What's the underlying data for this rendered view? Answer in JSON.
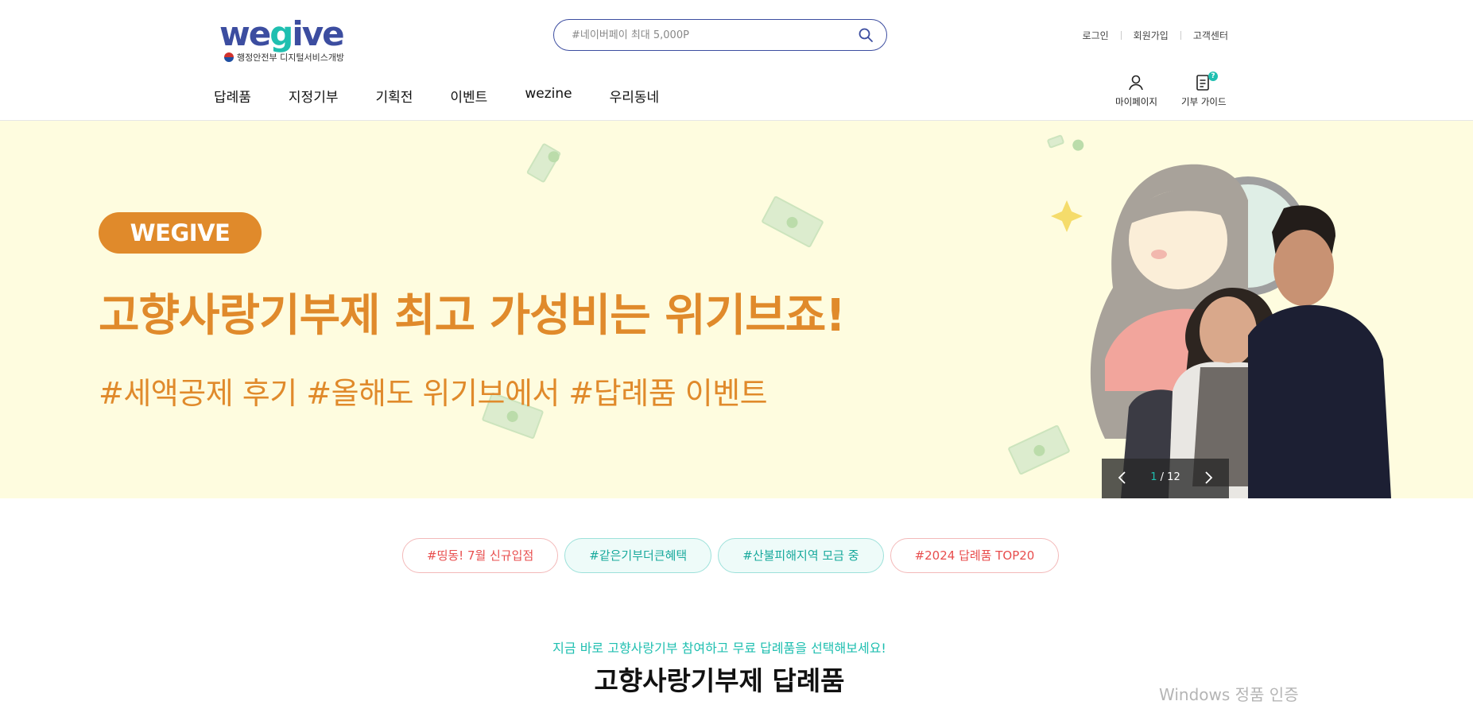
{
  "header": {
    "logo_text": "wegive",
    "logo_subtitle": "행정안전부 디지털서비스개방",
    "search_placeholder": "#네이버페이 최대 5,000P",
    "util_links": [
      "로그인",
      "회원가입",
      "고객센터"
    ],
    "nav": [
      "답례품",
      "지정기부",
      "기획전",
      "이벤트",
      "wezine",
      "우리동네"
    ],
    "quick_links": {
      "mypage": "마이페이지",
      "guide": "기부 가이드",
      "guide_badge": "?"
    }
  },
  "banner": {
    "pill": "WEGIVE",
    "headline": "고향사랑기부제 최고 가성비는 위기브죠!",
    "subline": "#세액공제 후기 #올해도 위기브에서 #답례품 이벤트",
    "slide_current": "1",
    "slide_total": "/ 12"
  },
  "tags": [
    {
      "label": "#띵동! 7월 신규입점",
      "style": "red"
    },
    {
      "label": "#같은기부더큰혜택",
      "style": "teal"
    },
    {
      "label": "#산불피해지역 모금 중",
      "style": "teal"
    },
    {
      "label": "#2024 답례품 TOP20",
      "style": "red"
    }
  ],
  "section": {
    "intro": "지금 바로 고향사랑기부 참여하고 무료 답례품을 선택해보세요!",
    "title": "고향사랑기부제 답례품"
  },
  "overlay": {
    "watermark": "Windows 정품 인증"
  },
  "colors": {
    "brand": "#3c4da0",
    "accent_teal": "#1fbfb0",
    "banner_orange": "#e08a2b",
    "banner_bg": "#fefcdf"
  }
}
